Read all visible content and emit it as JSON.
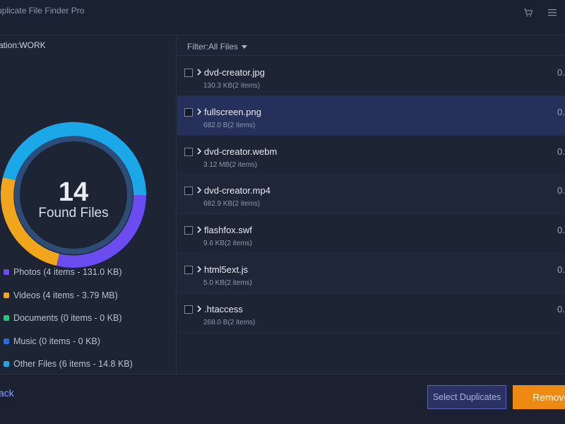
{
  "app": {
    "title": "uplicate File Finder Pro"
  },
  "location": {
    "label": "ation:WORK"
  },
  "summary": {
    "count": "14",
    "label": "Found Files"
  },
  "legend": [
    {
      "label": "Photos (4 items - 131.0 KB)",
      "color": "#6a4cf0"
    },
    {
      "label": "Videos (4 items - 3.79 MB)",
      "color": "#f0a51c"
    },
    {
      "label": "Documents (0 items - 0 KB)",
      "color": "#2bc27a"
    },
    {
      "label": "Music (0 items - 0 KB)",
      "color": "#1f6fe0"
    },
    {
      "label": "Other Files (6 items - 14.8 KB)",
      "color": "#1aa8e8"
    }
  ],
  "filter": {
    "label": "Filter:All Files"
  },
  "files": [
    {
      "name": "dvd-creator.jpg",
      "meta": "130.3 KB(2 items)",
      "size": "0."
    },
    {
      "name": "fullscreen.png",
      "meta": "682.0 B(2 items)",
      "size": "0."
    },
    {
      "name": "dvd-creator.webm",
      "meta": "3.12 MB(2 items)",
      "size": "0."
    },
    {
      "name": "dvd-creator.mp4",
      "meta": "682.9 KB(2 items)",
      "size": "0."
    },
    {
      "name": "flashfox.swf",
      "meta": "9.6 KB(2 items)",
      "size": "0."
    },
    {
      "name": "html5ext.js",
      "meta": "5.0 KB(2 items)",
      "size": "0."
    },
    {
      "name": ".htaccess",
      "meta": "268.0 B(2 items)",
      "size": "0."
    }
  ],
  "footer": {
    "back_label": "ack",
    "select_label": "Select Duplicates",
    "remove_label": "Remove"
  },
  "colors": {
    "accent": "#ee8a12",
    "selected_row": "#27305a"
  },
  "icons": {
    "cart": "cart-icon",
    "menu": "menu-icon"
  }
}
